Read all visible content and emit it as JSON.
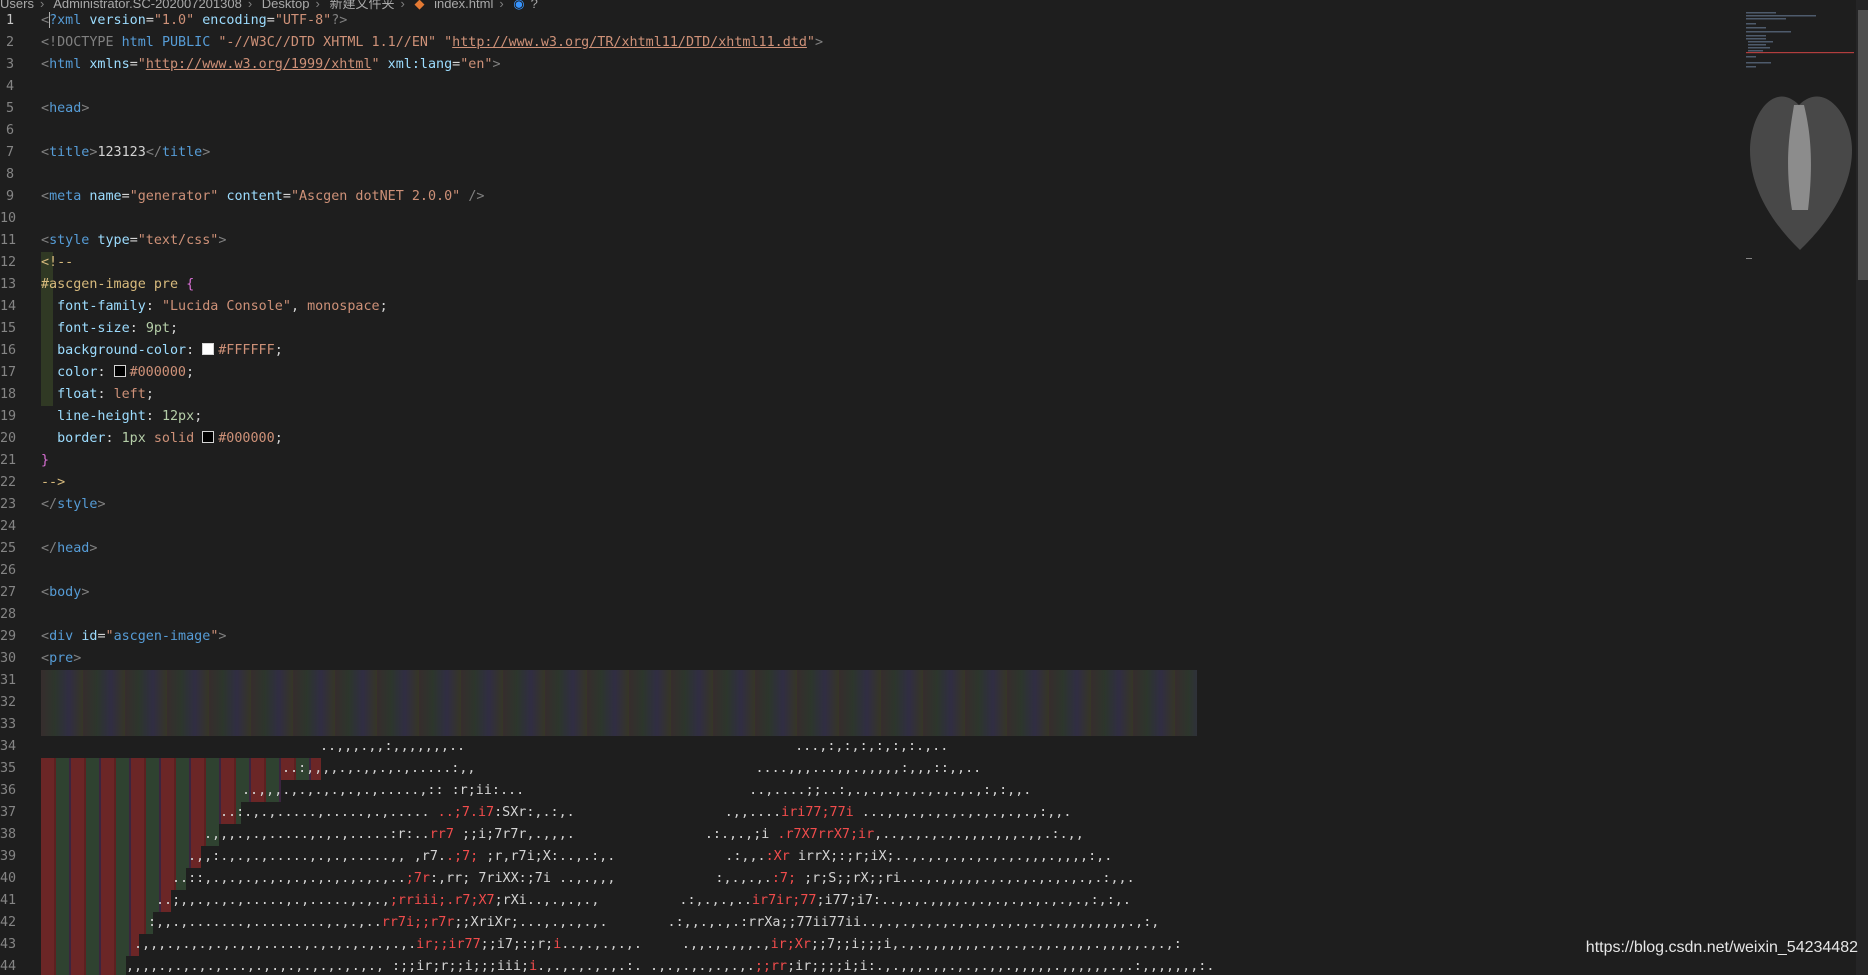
{
  "breadcrumb": [
    "Users",
    "Administrator.SC-202007201308",
    "Desktop",
    "新建文件夹",
    "index.html",
    "?"
  ],
  "code": {
    "l1_xml": "?xml",
    "l1_version_attr": "version",
    "l1_version_val": "\"1.0\"",
    "l1_encoding_attr": "encoding",
    "l1_encoding_val": "\"UTF-8\"",
    "l2_doctype": "<!DOCTYPE",
    "l2_html": "html",
    "l2_public": "PUBLIC",
    "l2_fpi": "\"-//W3C//DTD XHTML 1.1//EN\"",
    "l2_dtd_url": "http://www.w3.org/TR/xhtml11/DTD/xhtml11.dtd",
    "l3_html": "html",
    "l3_xmlns": "xmlns",
    "l3_xmlns_url": "http://www.w3.org/1999/xhtml",
    "l3_xmllang": "xml:lang",
    "l3_lang_val": "\"en\"",
    "head": "head",
    "title_tag": "title",
    "title_text": "123123",
    "meta": "meta",
    "meta_name_attr": "name",
    "meta_name_val": "\"generator\"",
    "meta_content_attr": "content",
    "meta_content_val": "\"Ascgen dotNET 2.0.0\"",
    "style": "style",
    "style_type_attr": "type",
    "style_type_val": "\"text/css\"",
    "comment_open": "<!--",
    "selector": "#ascgen-image pre",
    "font_family_prop": "font-family",
    "font_family_val1": "\"Lucida Console\"",
    "font_family_val2": "monospace",
    "font_size_prop": "font-size",
    "font_size_val": "9pt",
    "bg_prop": "background-color",
    "bg_val": "#FFFFFF",
    "color_prop": "color",
    "color_val": "#000000",
    "float_prop": "float",
    "float_val": "left",
    "lh_prop": "line-height",
    "lh_val": "12px",
    "border_prop": "border",
    "border_width": "1px",
    "border_style": "solid",
    "border_color": "#000000",
    "comment_close": "-->",
    "body": "body",
    "div": "div",
    "div_id_attr": "id",
    "div_id_val": "ascgen-image",
    "pre": "pre"
  },
  "ascii": {
    "l34a": "..,,,.,,:,,,,,,,..",
    "l34b": "...,:,:,:,:,:,:.,..",
    "l35a": "..:,,,,.,.,,.,.,.....:,,",
    "l35b": "....,,,...,,.,,,,,:,,,::,,..",
    "l36a": "..,,,.,.,.,.,.,.,.....,:: :r;ii:...",
    "l36b": "..,....;;..:,.,.,.,.,.,.,.,.,:,:,,.",
    "l37a": "..:.,.,.....,.....,.,.....",
    "l37r1": "..;7.i7",
    "l37b": ":SXr:,.:,.",
    "l37c": ".,,....",
    "l37r2": "iri77;77i",
    "l37d": "...,.,.,.,.,.,.,.,.,.,:,,.",
    "l38a": ".,,,.,.,.....,.,.,.....:r:..",
    "l38r1": "rr7",
    "l38b": ";;i;7r7r,.,,,.",
    "l38c": ".:.,.,;i",
    "l38r2": ".r7X7rrX7;ir",
    "l38d": ",..,.,.,.,.,,,.,,,.,,.:.,,",
    "l39a": ".,,:.,.,.,.....,.,.,.....,,",
    "l39b": ",r7.",
    "l39r1": ".;7;",
    "l39c": ";r,r7i;X:..,.:,.",
    "l39d": ".:,,.",
    "l39r2": ":Xr",
    "l39e": "irrX;:;r;iX;..,.,.,.,.,.,.,.,,,.,,,,:,.",
    "l40a": "..::,.,.,.,.,.,.,.,.,.,.,.,..",
    "l40r1": ";7r",
    "l40b": ":,rr; 7riXX:;7i ..,.,,,",
    "l40c": ":,.,.,.",
    "l40r2": ":7;",
    "l40d": ";r;S;;rX;;ri...,.,,,,,.,.,.,.,.,.,.,.:,,.",
    "l41a": "..;,,.,.,.,.....,.,.....,.,.,",
    "l41r1": ";rriii;.r7;X7",
    "l41b": ";rXi..,.,.,.,",
    "l41c": ".:,.,.,..",
    "l41r2": "ir7ir;77",
    "l41d": ";i77;i7:..,.,.,,,,.,.,.,.,.,.,.,.,:,:,.",
    "l42a": ":,,.,.......,.........,.,.,..",
    "l42r1": "rr7i;;r7r",
    "l42b": ";;XriXr;...,.,.,.,.",
    "l42c": ".:,,.,.,.:rrXa;;77ii77i",
    "l42d": "i..,.,.,.,.,.,.,.,.,.,.,.,,,,,,,,,.,:,",
    "l43a": ".,,,.,.,.,.,.,.,.....,.,.,.,.,.,.,.",
    "l43r1": "ir;;ir77",
    "l43b": ";;i7;:;r;",
    "l43r2": "i",
    "l43c": "..,.,.,.,.",
    "l43d": ".,,.,.,,,.,",
    "l43r3": "ir;Xr",
    "l43e": ";;7;;i;;;i,.,.,,,,,,,.,.,.,.,,.,,,,.,,,,,.,.,:",
    "l44a": ",,,,.,.,.,.,...,.,.,.,.,.,.,.,.,",
    "l44b": ":;;ir;r;;i;;;iii;",
    "l44r1": "i",
    "l44c": ".,.,.,.,.,.:.",
    "l44d": ".,.,.,.,.,.,.",
    "l44r2": ";;rr",
    "l44e": ";ir;;;;i;i:.,.,,,.,,.,.,.,,.,,,,,.,,,,,,.,.:,,,,,,,:."
  },
  "line_numbers": [
    "1",
    "2",
    "3",
    "4",
    "5",
    "6",
    "7",
    "8",
    "9",
    "10",
    "11",
    "12",
    "13",
    "14",
    "15",
    "16",
    "17",
    "18",
    "19",
    "20",
    "21",
    "22",
    "23",
    "24",
    "25",
    "26",
    "27",
    "28",
    "29",
    "30",
    "31",
    "32",
    "33",
    "34",
    "35",
    "36",
    "37",
    "38",
    "39",
    "40",
    "41",
    "42",
    "43",
    "44"
  ],
  "watermark": "https://blog.csdn.net/weixin_54234482",
  "colors": {
    "editor_bg": "#1e1e1e",
    "tag": "#569cd6",
    "attr": "#9cdcfe",
    "string": "#ce9178",
    "selector": "#d7ba7d",
    "ascii_red": "#f14c4c",
    "swatch_white": "#FFFFFF",
    "swatch_black": "#000000"
  }
}
